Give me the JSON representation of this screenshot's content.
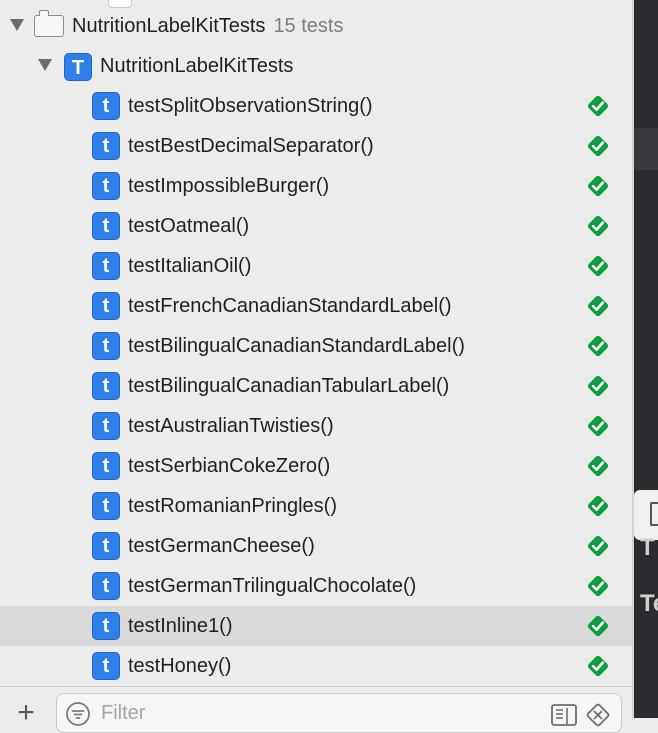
{
  "bundle": {
    "name": "NutritionLabelKitTests",
    "count_label": "15 tests"
  },
  "test_class": {
    "icon_letter": "T",
    "name": "NutritionLabelKitTests"
  },
  "test_icon_letter": "t",
  "tests": [
    {
      "name": "testSplitObservationString()",
      "status": "passed"
    },
    {
      "name": "testBestDecimalSeparator()",
      "status": "passed"
    },
    {
      "name": "testImpossibleBurger()",
      "status": "passed"
    },
    {
      "name": "testOatmeal()",
      "status": "passed"
    },
    {
      "name": "testItalianOil()",
      "status": "passed"
    },
    {
      "name": "testFrenchCanadianStandardLabel()",
      "status": "passed"
    },
    {
      "name": "testBilingualCanadianStandardLabel()",
      "status": "passed"
    },
    {
      "name": "testBilingualCanadianTabularLabel()",
      "status": "passed"
    },
    {
      "name": "testAustralianTwisties()",
      "status": "passed"
    },
    {
      "name": "testSerbianCokeZero()",
      "status": "passed"
    },
    {
      "name": "testRomanianPringles()",
      "status": "passed"
    },
    {
      "name": "testGermanCheese()",
      "status": "passed"
    },
    {
      "name": "testGermanTrilingualChocolate()",
      "status": "passed"
    },
    {
      "name": "testInline1()",
      "status": "passed",
      "selected": true
    },
    {
      "name": "testHoney()",
      "status": "passed"
    }
  ],
  "bottom_bar": {
    "add_label": "+",
    "filter_placeholder": "Filter"
  },
  "editor": {
    "fragment_1": "T",
    "fragment_2": "Te"
  },
  "colors": {
    "test_icon": "#2f7fe8",
    "passed": "#0f9d3f",
    "selection": "#dadada",
    "editor_bg": "#2b2b2f"
  },
  "icons": {
    "disclosure": "disclosure-triangle-icon",
    "bundle": "test-bundle-folder-icon",
    "class": "test-class-icon",
    "test": "test-method-icon",
    "status": "passed-checkmark-icon",
    "add": "plus-icon",
    "filter": "filter-icon",
    "scheme": "scheme-filter-icon",
    "clear": "clear-x-icon"
  }
}
